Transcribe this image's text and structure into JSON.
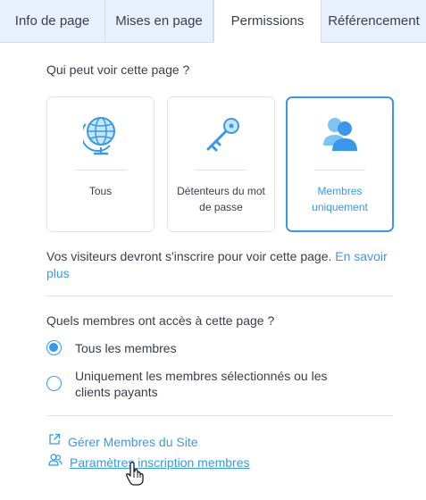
{
  "tabs": [
    {
      "label": "Info de page",
      "active": false
    },
    {
      "label": "Mises en page",
      "active": false
    },
    {
      "label": "Permissions",
      "active": true
    },
    {
      "label": "Référencement",
      "active": false
    }
  ],
  "who_can_see": {
    "question": "Qui peut voir cette page ?",
    "options": [
      {
        "label": "Tous",
        "icon": "globe-icon",
        "selected": false
      },
      {
        "label": "Détenteurs du mot de passe",
        "icon": "key-icon",
        "selected": false
      },
      {
        "label": "Membres uniquement",
        "icon": "members-icon",
        "selected": true
      }
    ]
  },
  "info": {
    "text": "Vos visiteurs devront s'inscrire pour voir cette page.",
    "link": "En savoir plus"
  },
  "member_access": {
    "question": "Quels membres ont accès à cette page ?",
    "options": [
      {
        "label": "Tous les membres",
        "selected": true
      },
      {
        "label": "Uniquement les membres sélectionnés ou les clients payants",
        "selected": false
      }
    ]
  },
  "links": {
    "manage_members": "Gérer Membres du Site",
    "signup_settings": "Paramètres inscription membres"
  },
  "colors": {
    "accent": "#3899ec",
    "tab_bg": "#e7f0fb",
    "text": "#3b3d4a"
  }
}
